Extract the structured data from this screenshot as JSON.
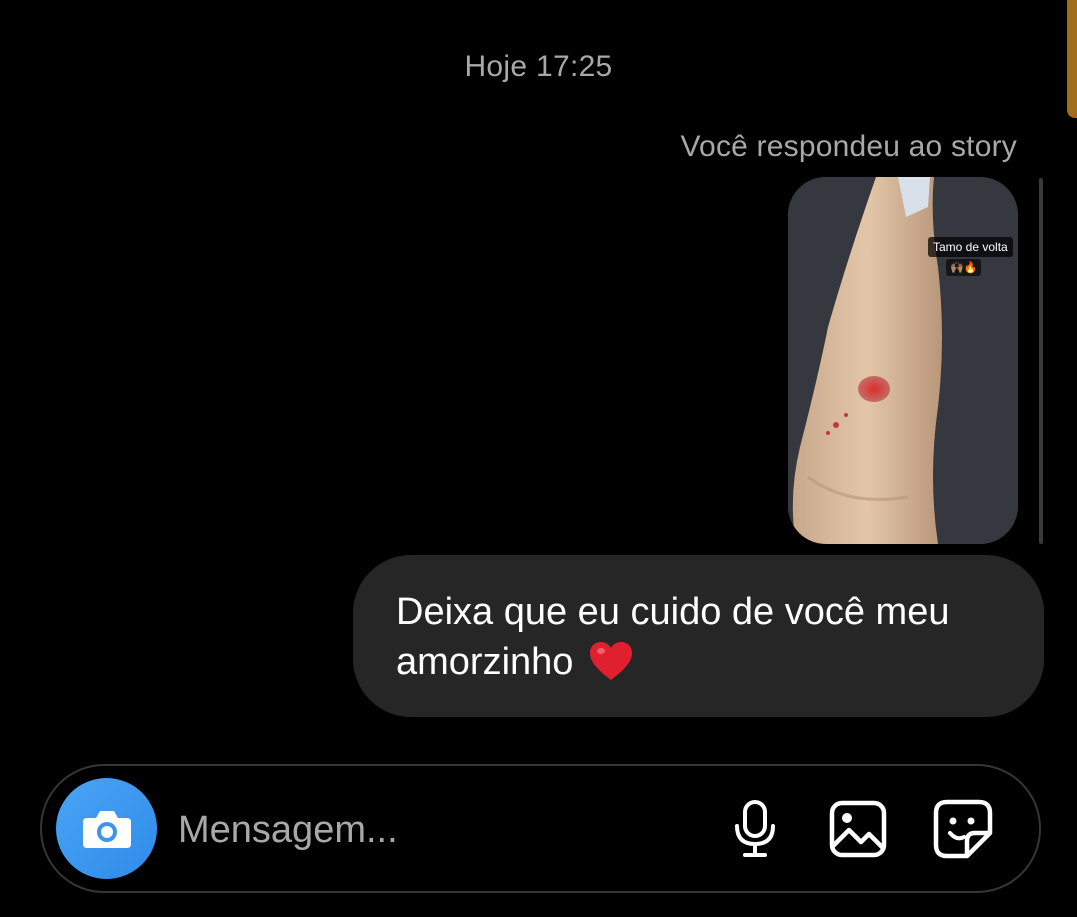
{
  "thread": {
    "timestamp": "Hoje 17:25",
    "reply_caption": "Você respondeu ao story",
    "story": {
      "sticker_text": "Tamo de volta",
      "sticker_emoji": "🙌🏽🔥"
    },
    "message": {
      "text": "Deixa que eu cuido de você meu amorzinho",
      "emoji": "heart-emoji"
    }
  },
  "composer": {
    "placeholder": "Mensagem...",
    "value": "",
    "icons": {
      "camera": "camera-icon",
      "mic": "microphone-icon",
      "gallery": "gallery-icon",
      "sticker": "sticker-icon"
    }
  },
  "colors": {
    "background": "#000000",
    "bubble": "#262626",
    "muted_text": "#a8a8a8",
    "camera_button": "#3b95ee",
    "heart": "#e0202e"
  }
}
